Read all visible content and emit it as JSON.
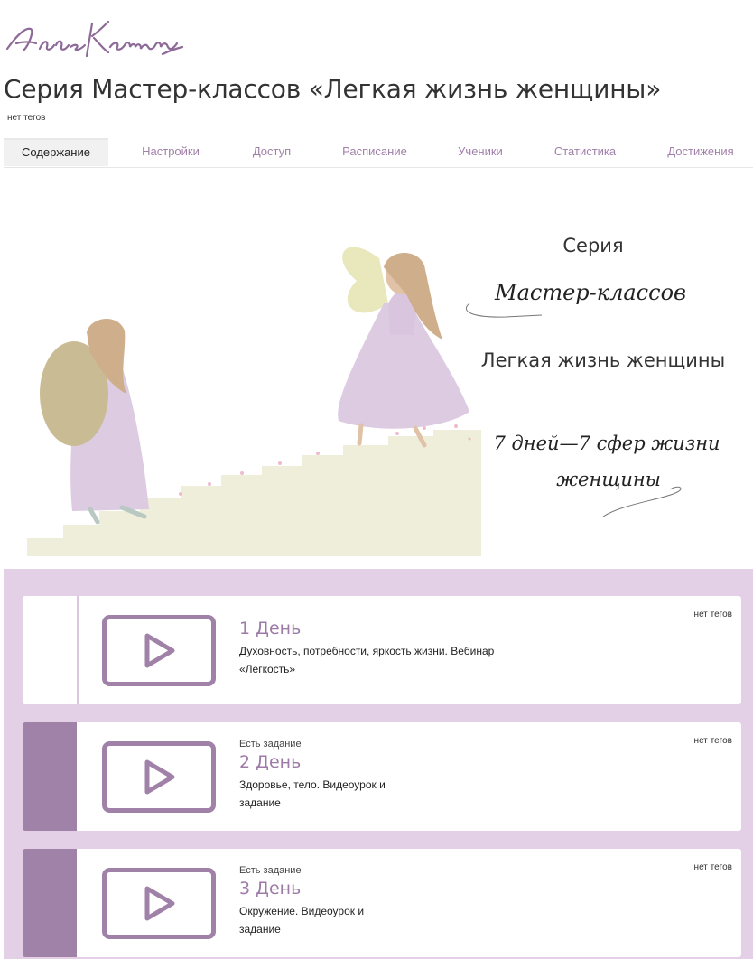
{
  "header": {
    "logo_text": "Алёна Ковальчук",
    "title": "Серия Мастер-классов «Легкая жизнь женщины»",
    "tags": "нет тегов"
  },
  "tabs": [
    {
      "label": "Содержание",
      "active": true
    },
    {
      "label": "Настройки"
    },
    {
      "label": "Доступ"
    },
    {
      "label": "Расписание"
    },
    {
      "label": "Ученики"
    },
    {
      "label": "Статистика"
    },
    {
      "label": "Достижения"
    }
  ],
  "banner": {
    "line1": "Серия",
    "line2": "Мастер-классов",
    "line3": "Легкая жизнь женщины",
    "line4": "7 дней—7 сфер жизни",
    "line5": "женщины"
  },
  "lessons": [
    {
      "task": "",
      "title": "1 День",
      "desc_line1": "Духовность, потребности, яркость жизни. Вебинар",
      "desc_line2": "«Легкость»",
      "tags": "нет тегов",
      "completed": false
    },
    {
      "task": "Есть задание",
      "title": "2 День",
      "desc_line1": "Здоровье, тело. Видеоурок и",
      "desc_line2": "задание",
      "tags": "нет тегов",
      "completed": true
    },
    {
      "task": "Есть задание",
      "title": "3 День",
      "desc_line1": "Окружение. Видеоурок и",
      "desc_line2": "задание",
      "tags": "нет тегов",
      "completed": true
    }
  ],
  "colors": {
    "accent": "#a081a8",
    "panel": "#e3cfe6",
    "tab_text": "#a07fa9"
  }
}
